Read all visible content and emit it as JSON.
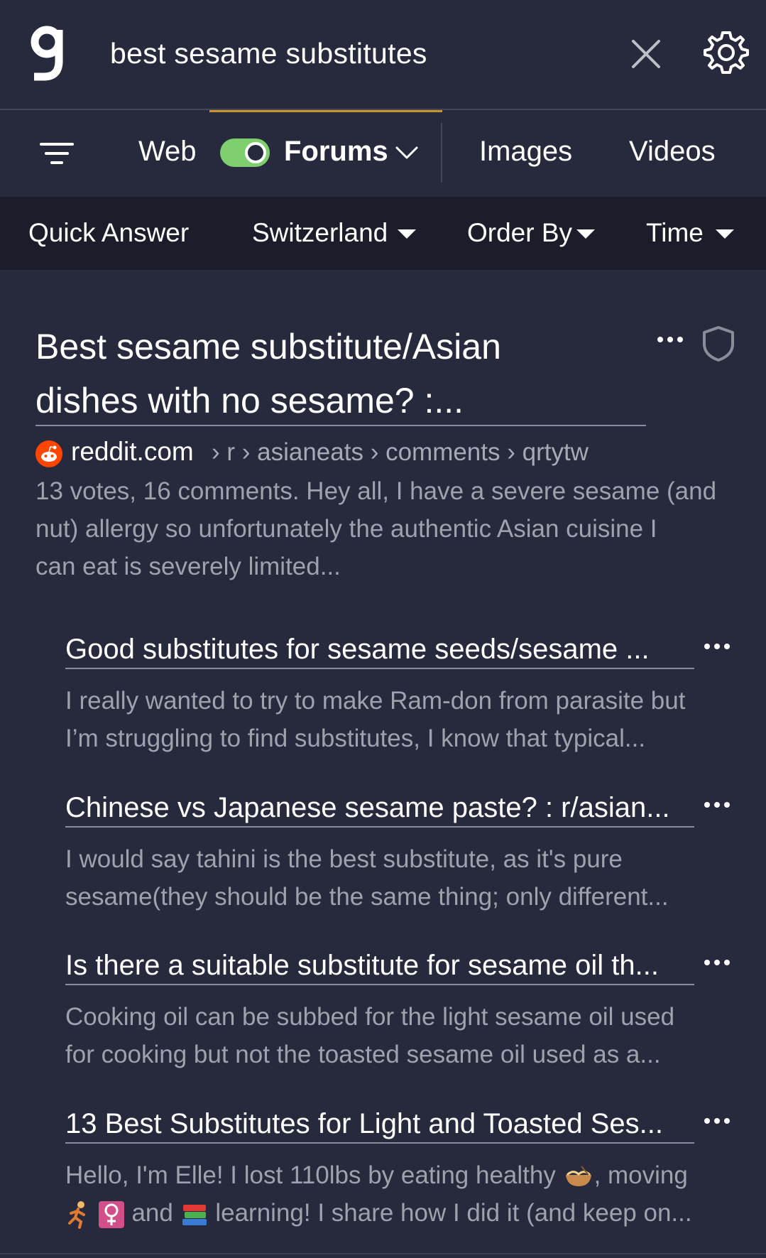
{
  "search": {
    "query": "best sesame substitutes"
  },
  "tabs": {
    "web": "Web",
    "forums": "Forums",
    "images": "Images",
    "videos": "Videos",
    "forums_toggle_on": true
  },
  "filters": {
    "quick_answer": "Quick Answer",
    "region": "Switzerland",
    "order_by": "Order By",
    "time": "Time"
  },
  "main_result": {
    "title_line1": "Best sesame substitute/Asian",
    "title_line2": "dishes with no sesame? :...",
    "domain": "reddit.com",
    "path": "› r › asianeats › comments › qrtytw",
    "snippet_line1": "13 votes, 16 comments. Hey all, I have a severe sesame (and",
    "snippet_line2": "nut) allergy so unfortunately the authentic Asian cuisine I",
    "snippet_line3": "can eat is severely limited..."
  },
  "sub_results": [
    {
      "title": "Good substitutes for sesame seeds/sesame ...",
      "snippet_line1": "I really wanted to try to make Ram-don from parasite but",
      "snippet_line2": "I’m struggling to find substitutes, I know that typical..."
    },
    {
      "title": "Chinese vs Japanese sesame paste? : r/asian...",
      "snippet_line1": "I would say tahini is the best substitute, as it's pure",
      "snippet_line2": "sesame(they should be the same thing; only different..."
    },
    {
      "title": "Is there a suitable substitute for sesame oil th...",
      "snippet_line1": "Cooking oil can be subbed for the light sesame oil used",
      "snippet_line2": "for cooking but not the toasted sesame oil used as a..."
    },
    {
      "title": "13 Best Substitutes for Light and Toasted Ses...",
      "snippet_line1_a": "Hello, I'm Elle! I lost 110lbs by eating healthy",
      "snippet_line1_b": ", moving",
      "snippet_line2_a": "and",
      "snippet_line2_b": "learning! I share how I did it (and keep on..."
    }
  ],
  "colors": {
    "background": "#272a3d",
    "filter_bar": "#1b1d2b",
    "accent_underline": "#c7962b",
    "toggle_on": "#7fcf6e",
    "snippet_text": "#9fa1ad",
    "reddit_orange": "#ff4500"
  },
  "icons": {
    "logo": "g-logo-icon",
    "clear": "close-icon",
    "settings": "gear-icon",
    "filter": "filter-lines-icon",
    "forums_dropdown": "chevron-down-icon",
    "more": "more-dots-icon",
    "shield": "shield-icon",
    "favicon": "reddit-icon"
  }
}
